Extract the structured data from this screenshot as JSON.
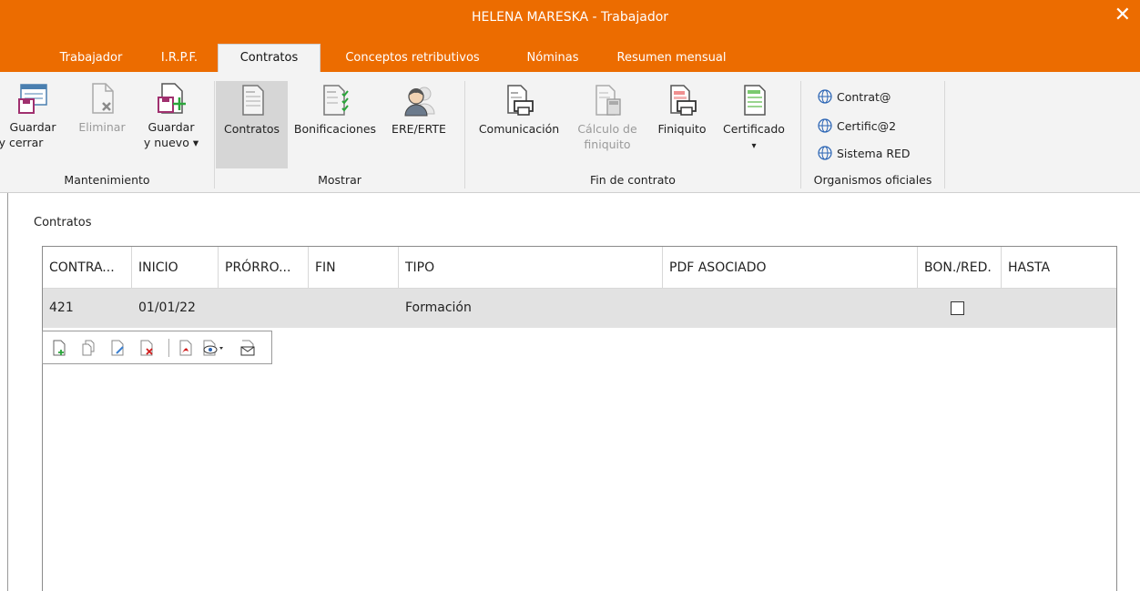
{
  "window": {
    "title": "HELENA MARESKA - Trabajador"
  },
  "tabs": [
    {
      "label": "Trabajador"
    },
    {
      "label": "I.R.P.F."
    },
    {
      "label": "Contratos",
      "active": true
    },
    {
      "label": "Conceptos retributivos"
    },
    {
      "label": "Nóminas"
    },
    {
      "label": "Resumen mensual"
    }
  ],
  "ribbon": {
    "mantenimiento": {
      "label": "Mantenimiento",
      "guardar_cerrar": [
        "Guardar",
        "y cerrar"
      ],
      "eliminar": "Eliminar",
      "guardar_nuevo": [
        "Guardar",
        "y nuevo ▾"
      ]
    },
    "mostrar": {
      "label": "Mostrar",
      "contratos": "Contratos",
      "bonificaciones": "Bonificaciones",
      "ere_erte": "ERE/ERTE"
    },
    "fin": {
      "label": "Fin de contrato",
      "comunicacion": "Comunicación",
      "calculo": [
        "Cálculo de",
        "finiquito"
      ],
      "finiquito": "Finiquito",
      "certificado": [
        "Certificado",
        "▾"
      ]
    },
    "organismos": {
      "label": "Organismos oficiales",
      "items": [
        "Contrat@",
        "Certific@2",
        "Sistema RED"
      ]
    }
  },
  "content": {
    "section_label": "Contratos",
    "columns": [
      "CONTRA...",
      "INICIO",
      "PRÓRRO...",
      "FIN",
      "TIPO",
      "PDF ASOCIADO",
      "BON./RED.",
      "HASTA"
    ],
    "rows": [
      {
        "contrato": "421",
        "inicio": "01/01/22",
        "prorroga": "",
        "fin": "",
        "tipo": "Formación",
        "pdf": "",
        "bonificado": false,
        "hasta": ""
      }
    ]
  },
  "icons": {
    "close": "close-icon",
    "row_tools": [
      "new-document-icon",
      "copy-document-icon",
      "edit-document-icon",
      "delete-document-icon",
      "pdf-icon",
      "view-icon",
      "email-icon"
    ]
  },
  "colors": {
    "accent": "#ec6c00",
    "ribbon_bg": "#f3f3f3",
    "selected_row": "#e2e2e2"
  }
}
